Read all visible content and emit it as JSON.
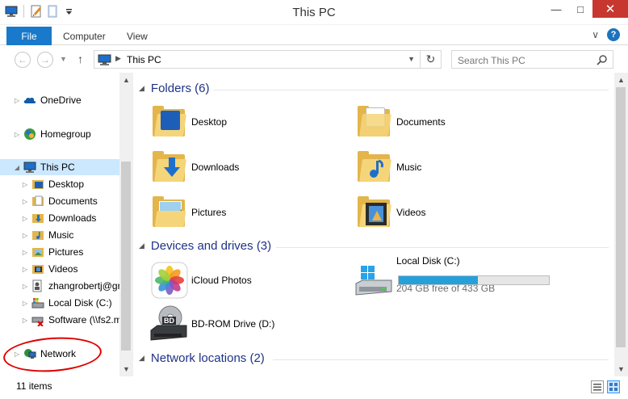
{
  "window": {
    "title": "This PC"
  },
  "ribbon": {
    "tabs": [
      "File",
      "Computer",
      "View"
    ]
  },
  "address": {
    "path": "This PC",
    "search_placeholder": "Search This PC"
  },
  "nav": {
    "items": [
      {
        "label": "OneDrive",
        "icon": "onedrive-icon"
      },
      {
        "label": "Homegroup",
        "icon": "homegroup-icon"
      },
      {
        "label": "This PC",
        "icon": "computer-icon",
        "selected": true
      },
      {
        "label": "Desktop",
        "icon": "desktop-folder-icon"
      },
      {
        "label": "Documents",
        "icon": "documents-folder-icon"
      },
      {
        "label": "Downloads",
        "icon": "downloads-folder-icon"
      },
      {
        "label": "Music",
        "icon": "music-folder-icon"
      },
      {
        "label": "Pictures",
        "icon": "pictures-folder-icon"
      },
      {
        "label": "Videos",
        "icon": "videos-folder-icon"
      },
      {
        "label": "zhangrobertj@gr",
        "icon": "icloud-user-icon"
      },
      {
        "label": "Local Disk (C:)",
        "icon": "local-disk-icon"
      },
      {
        "label": "Software (\\\\fs2.m",
        "icon": "network-drive-disconnected-icon"
      },
      {
        "label": "Network",
        "icon": "network-icon"
      }
    ]
  },
  "content": {
    "folders_header": "Folders (6)",
    "folders": [
      {
        "label": "Desktop",
        "icon": "desktop-folder-icon"
      },
      {
        "label": "Documents",
        "icon": "documents-folder-icon"
      },
      {
        "label": "Downloads",
        "icon": "downloads-folder-icon"
      },
      {
        "label": "Music",
        "icon": "music-folder-icon"
      },
      {
        "label": "Pictures",
        "icon": "pictures-folder-icon"
      },
      {
        "label": "Videos",
        "icon": "videos-folder-icon"
      }
    ],
    "devices_header": "Devices and drives (3)",
    "devices": [
      {
        "label": "iCloud Photos",
        "icon": "icloud-photos-icon"
      },
      {
        "label": "Local Disk (C:)",
        "icon": "local-disk-icon",
        "free_text": "204 GB free of 433 GB",
        "used_fraction": 0.529
      },
      {
        "label": "BD-ROM Drive (D:)",
        "icon": "bd-rom-icon",
        "badge": "BD"
      }
    ],
    "network_header": "Network locations (2)"
  },
  "status": {
    "items_count": "11 items"
  },
  "colors": {
    "accent": "#1979ca",
    "selection": "#cce8ff",
    "group_header": "#1e3287",
    "close_button": "#c7372f",
    "disk_bar": "#26a0da"
  }
}
